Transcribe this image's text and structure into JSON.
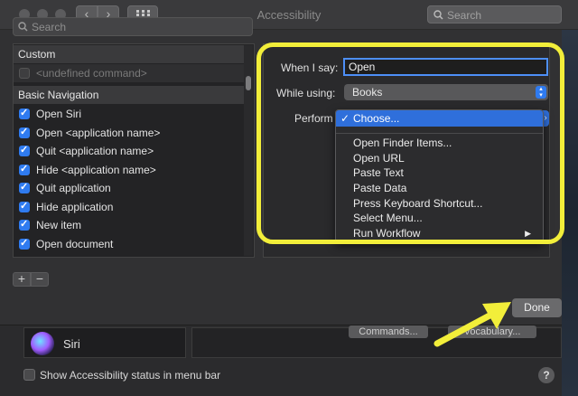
{
  "window": {
    "title": "Accessibility",
    "search_placeholder": "Search"
  },
  "commands_list": {
    "search_placeholder": "Search",
    "groups": [
      {
        "header": "Custom",
        "items": [
          {
            "label": "<undefined command>",
            "checked": false
          }
        ]
      },
      {
        "header": "Basic Navigation",
        "items": [
          {
            "label": "Open Siri",
            "checked": true
          },
          {
            "label": "Open <application name>",
            "checked": true
          },
          {
            "label": "Quit <application name>",
            "checked": true
          },
          {
            "label": "Hide <application name>",
            "checked": true
          },
          {
            "label": "Quit application",
            "checked": true
          },
          {
            "label": "Hide application",
            "checked": true
          },
          {
            "label": "New item",
            "checked": true
          },
          {
            "label": "Open document",
            "checked": true
          }
        ]
      }
    ],
    "add_label": "+",
    "remove_label": "−"
  },
  "command_editor": {
    "when_i_say_label": "When I say:",
    "when_i_say_value": "Open",
    "while_using_label": "While using:",
    "while_using_value": "Books",
    "perform_label": "Perform",
    "perform_menu": {
      "selected": "Choose...",
      "items": [
        {
          "label": "Open Finder Items...",
          "submenu": false
        },
        {
          "label": "Open URL",
          "submenu": false
        },
        {
          "label": "Paste Text",
          "submenu": false
        },
        {
          "label": "Paste Data",
          "submenu": false
        },
        {
          "label": "Press Keyboard Shortcut...",
          "submenu": false
        },
        {
          "label": "Select Menu...",
          "submenu": false
        },
        {
          "label": "Run Workflow",
          "submenu": true
        }
      ]
    }
  },
  "done_label": "Done",
  "background_pane": {
    "siri_label": "Siri",
    "commands_button": "Commands...",
    "vocabulary_button": "Vocabulary...",
    "status_checkbox_label": "Show Accessibility status in menu bar",
    "help_label": "?"
  },
  "icons": {
    "search": "search-icon",
    "checkmark": "checkmark-icon",
    "siri": "siri-icon"
  },
  "colors": {
    "highlight": "#f2ee3a",
    "accent": "#2f7bf0",
    "menu_selected": "#2f6fdb"
  }
}
